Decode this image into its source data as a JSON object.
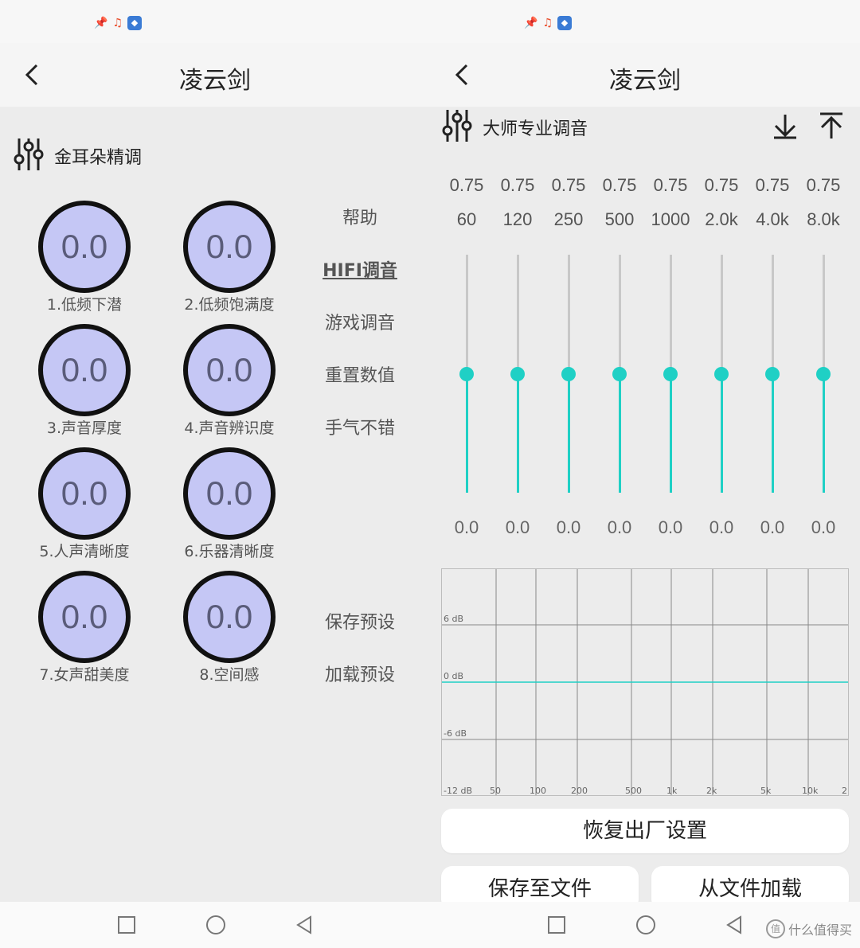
{
  "left": {
    "app_title": "凌云剑",
    "section_title": "金耳朵精调",
    "knobs": [
      {
        "value": "0.0",
        "label": "1.低频下潜"
      },
      {
        "value": "0.0",
        "label": "2.低频饱满度"
      },
      {
        "value": "0.0",
        "label": "3.声音厚度"
      },
      {
        "value": "0.0",
        "label": "4.声音辨识度"
      },
      {
        "value": "0.0",
        "label": "5.人声清晰度"
      },
      {
        "value": "0.0",
        "label": "6.乐器清晰度"
      },
      {
        "value": "0.0",
        "label": "7.女声甜美度"
      },
      {
        "value": "0.0",
        "label": "8.空间感"
      }
    ],
    "menu": [
      "帮助",
      "HIFI调音",
      "游戏调音",
      "重置数值",
      "手气不错"
    ],
    "menu_active": "HIFI调音",
    "preset_menu": [
      "保存预设",
      "加载预设"
    ]
  },
  "right": {
    "app_title": "凌云剑",
    "section_title": "大师专业调音",
    "bands": [
      {
        "q": "0.75",
        "freq": "60",
        "gain": "0.0"
      },
      {
        "q": "0.75",
        "freq": "120",
        "gain": "0.0"
      },
      {
        "q": "0.75",
        "freq": "250",
        "gain": "0.0"
      },
      {
        "q": "0.75",
        "freq": "500",
        "gain": "0.0"
      },
      {
        "q": "0.75",
        "freq": "1000",
        "gain": "0.0"
      },
      {
        "q": "0.75",
        "freq": "2.0k",
        "gain": "0.0"
      },
      {
        "q": "0.75",
        "freq": "4.0k",
        "gain": "0.0"
      },
      {
        "q": "0.75",
        "freq": "8.0k",
        "gain": "0.0"
      }
    ],
    "slider_level_percent": 50,
    "graph": {
      "db_labels": [
        "6 dB",
        "0 dB",
        "-6 dB",
        "-12 dB"
      ],
      "freq_labels": [
        "50",
        "100",
        "200",
        "500",
        "1k",
        "2k",
        "5k",
        "10k",
        "2"
      ],
      "curve_gain_db": 0,
      "curve_color": "#1fd0c5"
    },
    "buttons": {
      "reset": "恢复出厂设置",
      "save_file": "保存至文件",
      "load_file": "从文件加载"
    },
    "watermark": "什么值得买"
  },
  "icons": [
    "back-arrow-icon",
    "equalizer-icon",
    "download-icon",
    "upload-icon",
    "nav-square-icon",
    "nav-home-icon",
    "nav-back-icon"
  ],
  "colors": {
    "accent": "#1fd0c5",
    "knob_fill": "#c5c7f5",
    "knob_border": "#111111"
  }
}
